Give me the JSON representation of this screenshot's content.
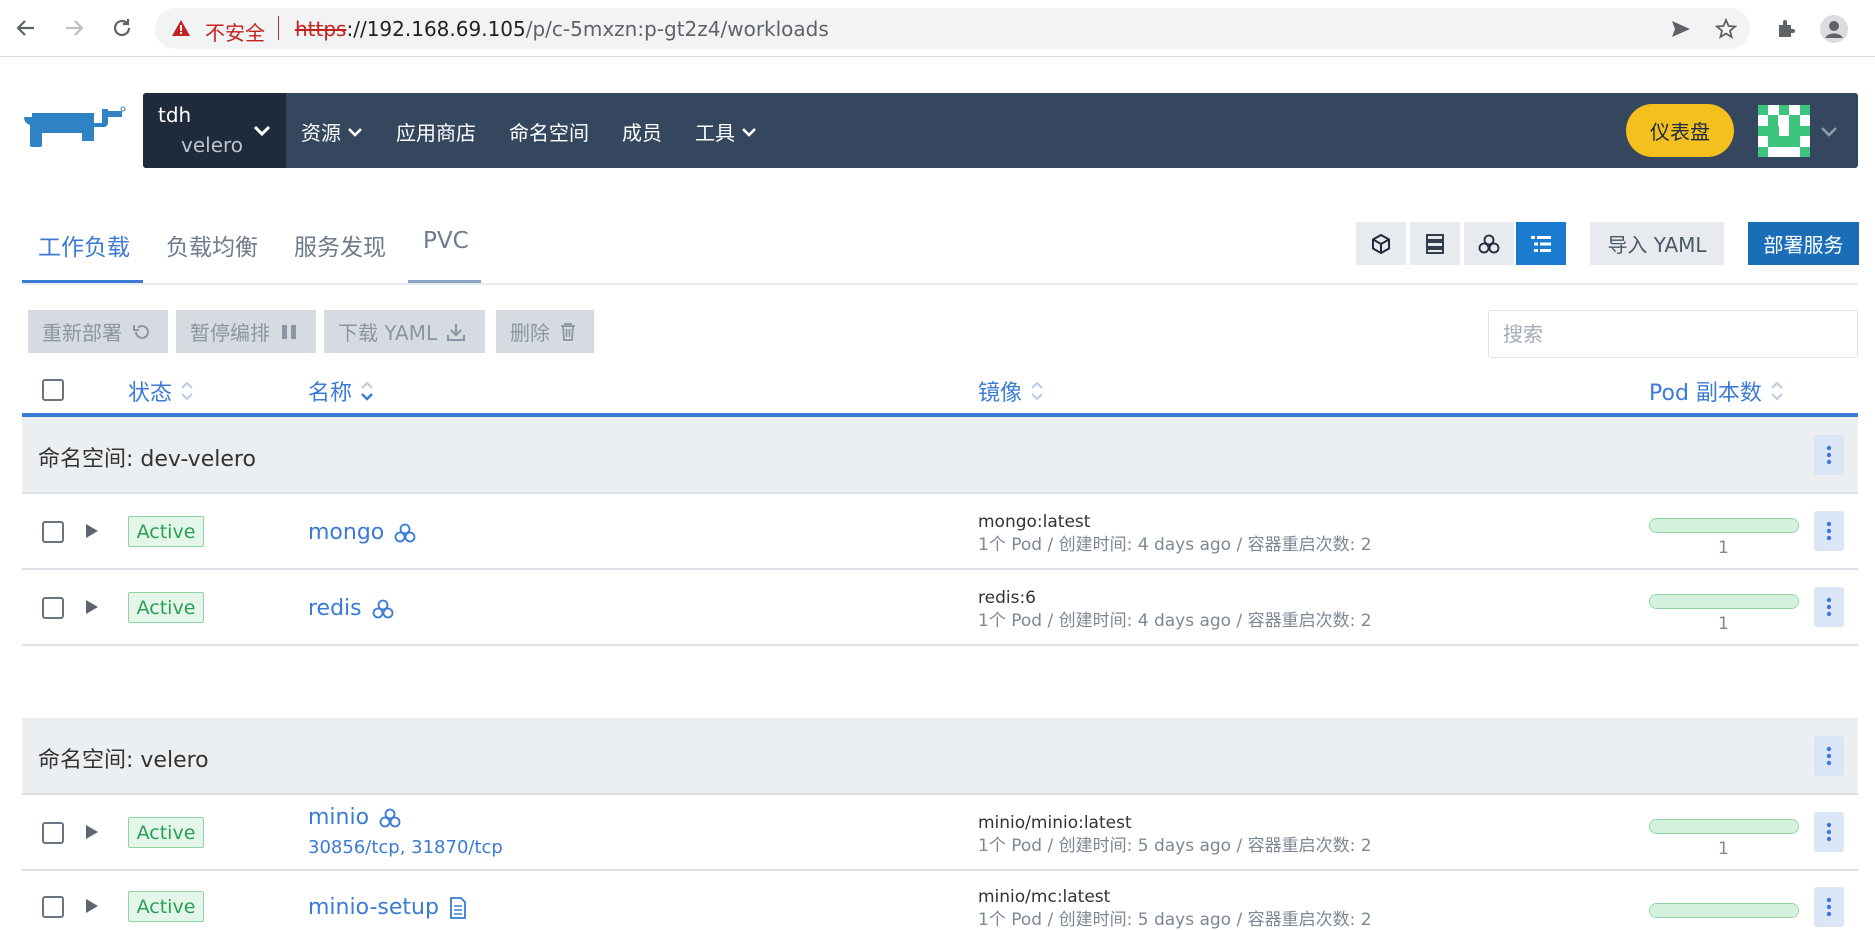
{
  "browser": {
    "insecure_label": "不安全",
    "url_scheme": "https",
    "url_host": "://192.168.69.105",
    "url_path": "/p/c-5mxzn:p-gt2z4/workloads"
  },
  "header": {
    "cluster_name": "tdh",
    "project_name": "velero",
    "nav": [
      {
        "label": "资源",
        "dropdown": true
      },
      {
        "label": "应用商店",
        "dropdown": false
      },
      {
        "label": "命名空间",
        "dropdown": false
      },
      {
        "label": "成员",
        "dropdown": false
      },
      {
        "label": "工具",
        "dropdown": true
      }
    ],
    "dashboard_label": "仪表盘"
  },
  "tabs": [
    {
      "label": "工作负载",
      "active": true
    },
    {
      "label": "负载均衡",
      "active": false
    },
    {
      "label": "服务发现",
      "active": false
    },
    {
      "label": "PVC",
      "active": false
    }
  ],
  "toolbar": {
    "import_label": "导入 YAML",
    "deploy_label": "部署服务"
  },
  "actions": {
    "redeploy": "重新部署",
    "pause": "暂停编排",
    "download": "下载 YAML",
    "delete": "删除",
    "search_placeholder": "搜索"
  },
  "table": {
    "headers": {
      "state": "状态",
      "name": "名称",
      "image": "镜像",
      "pods": "Pod 副本数"
    },
    "groups": [
      {
        "label": "命名空间: dev-velero",
        "rows": [
          {
            "state": "Active",
            "name": "mongo",
            "ports": "",
            "image": "mongo:latest",
            "meta": "1个 Pod / 创建时间: 4 days ago / 容器重启次数: 2",
            "pods": "1"
          },
          {
            "state": "Active",
            "name": "redis",
            "ports": "",
            "image": "redis:6",
            "meta": "1个 Pod / 创建时间: 4 days ago / 容器重启次数: 2",
            "pods": "1"
          }
        ]
      },
      {
        "label": "命名空间: velero",
        "rows": [
          {
            "state": "Active",
            "name": "minio",
            "ports": "30856/tcp, 31870/tcp",
            "image": "minio/minio:latest",
            "meta": "1个 Pod / 创建时间: 5 days ago / 容器重启次数: 2",
            "pods": "1"
          },
          {
            "state": "Active",
            "name": "minio-setup",
            "ports": "",
            "image": "minio/mc:latest",
            "meta": "1个 Pod / 创建时间: 5 days ago / 容器重启次数: 2",
            "pods": ""
          }
        ]
      }
    ]
  },
  "colors": {
    "accent": "#3b7bd6",
    "header_bg": "#34475e",
    "dashboard": "#f3c01d",
    "active_green": "#2a9e54"
  }
}
